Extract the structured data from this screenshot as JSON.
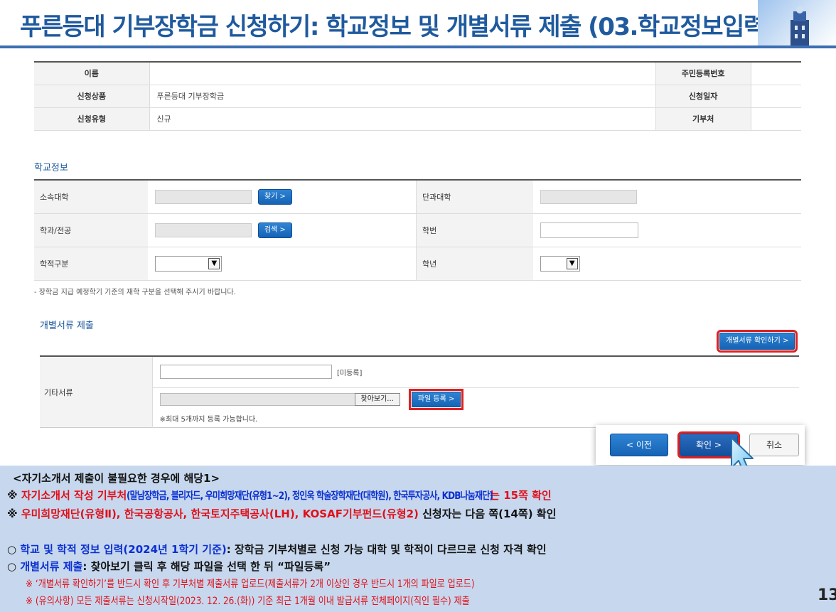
{
  "header": {
    "title": "푸른등대 기부장학금 신청하기: 학교정보 및 개별서류 제출 (03.학교정보입력)"
  },
  "applicant_info": {
    "rows": [
      {
        "label1": "이름",
        "value1": "",
        "label2": "주민등록번호",
        "value2": ""
      },
      {
        "label1": "신청상품",
        "value1": "푸른등대 기부장학금",
        "label2": "신청일자",
        "value2": ""
      },
      {
        "label1": "신청유형",
        "value1": "신규",
        "label2": "기부처",
        "value2": ""
      }
    ]
  },
  "school_section": {
    "title": "학교정보",
    "university_label": "소속대학",
    "find_button": "찾기 >",
    "college_label": "단과대학",
    "major_label": "학과/전공",
    "search_button": "검색 >",
    "student_id_label": "학번",
    "enrollment_label": "학적구분",
    "grade_label": "학년",
    "note": "- 장학금 지급 예정학기 기준의 재학 구분을 선택해 주시기 바랍니다."
  },
  "documents_section": {
    "title": "개별서류 제출",
    "check_button": "개별서류 확인하기 >",
    "row_label": "기타서류",
    "status": "[미등록]",
    "browse_button": "찾아보기...",
    "register_button": "파일 등록 >",
    "max_note": "※최대 5개까지 등록 가능합니다."
  },
  "nav": {
    "prev": "< 이전",
    "ok": "확인 >",
    "cancel": "취소"
  },
  "notes": {
    "heading": "<자기소개서 제출이 불필요한 경우에 해당1>",
    "line1_mark": "※ ",
    "line1_red": "자기소개서 작성 기부처",
    "line1_blue": "(말남장학금, 블리자드, 우미희망재단(유형1~2), 정인욱 학술장학재단(대학원), 한국투자공사, KDB나눔재단)",
    "line1_end": "는 15쪽 확인",
    "line2_mark": "※ ",
    "line2_red": "우미희망재단(유형Ⅱ), 한국공항공사, 한국토지주택공사(LH), KOSAF기부펀드(유형2)",
    "line2_end": " 신청자는 다음 쪽(14쪽) 확인",
    "line3_mark": "○ ",
    "line3_blue": "학교 및 학적 정보 입력(2024년 1학기 기준)",
    "line3_end": ": 장학금 기부처별로 신청 가능 대학 및 학적이 다르므로 신청 자격 확인",
    "line4_mark": "○ ",
    "line4_blue": "개별서류 제출",
    "line4_end": ": 찾아보기 클릭 후 해당 파일을 선택 한 뒤 “파일등록”",
    "line5": "※ ‘개별서류 확인하기’를 반드시 확인 후 기부처별 제출서류 업로드(제출서류가 2개 이상인 경우 반드시 1개의 파일로 업로드)",
    "line6": "※ (유의사항) 모든 제출서류는 신청시작일(2023. 12. 26.(화)) 기준 최근 1개월 이내 발급서류 전체페이지(직인 필수) 제출"
  },
  "page_number": "13"
}
